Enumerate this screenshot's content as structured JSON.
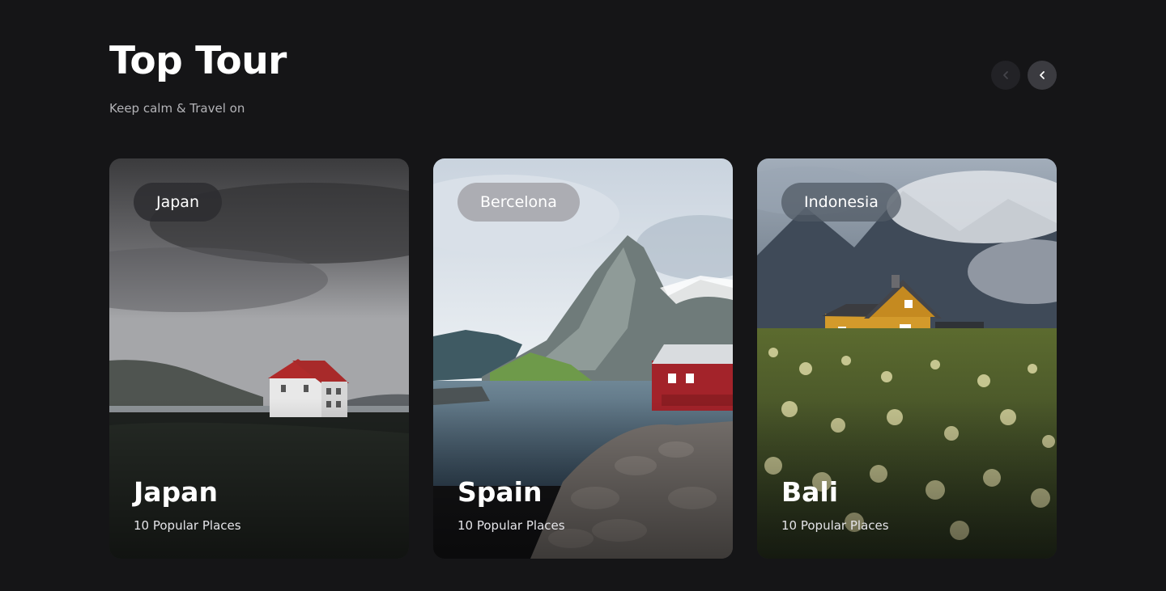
{
  "header": {
    "title": "Top Tour",
    "subtitle": "Keep calm & Travel on"
  },
  "nav": {
    "prev_icon": "chevron-left-icon",
    "next_icon": "chevron-left-icon"
  },
  "cards": [
    {
      "tag": "Japan",
      "title": "Japan",
      "subtitle": "10 Popular Places"
    },
    {
      "tag": "Bercelona",
      "title": "Spain",
      "subtitle": "10 Popular Places"
    },
    {
      "tag": "Indonesia",
      "title": "Bali",
      "subtitle": "10 Popular Places"
    }
  ],
  "colors": {
    "background": "#151517",
    "text": "#ffffff",
    "muted_text": "#b4b4b8"
  }
}
